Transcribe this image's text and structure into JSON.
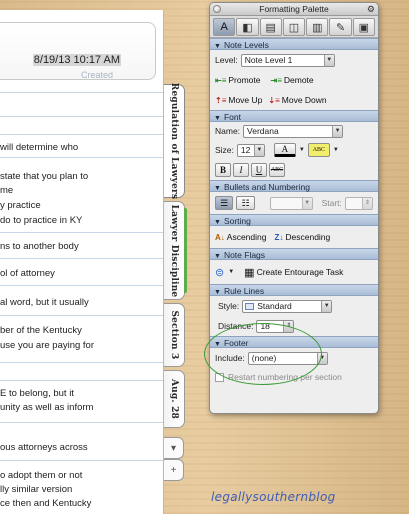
{
  "note": {
    "date_time": "8/19/13 10:17 AM",
    "created_label": "Created",
    "lines": [
      {
        "text": "will determine who"
      },
      {
        "text": "state that you plan to"
      },
      {
        "text": "me"
      },
      {
        "text": "y practice"
      },
      {
        "text": "do to practice in KY"
      },
      {
        "text": "ns to another body"
      },
      {
        "text": "ol of attorney"
      },
      {
        "text": "al word, but it usually"
      },
      {
        "text": "ber of the Kentucky"
      },
      {
        "text": "use you are paying for"
      },
      {
        "text": "E to belong, but it"
      },
      {
        "text": "unity as well as inform"
      },
      {
        "text": "ous attorneys across"
      },
      {
        "text": "o adopt them or not"
      },
      {
        "text": "lly similar version"
      },
      {
        "text": "ce then and Kentucky"
      }
    ]
  },
  "tabs": [
    {
      "label": "Regulation of Lawyers"
    },
    {
      "label": "Lawyer Discipline"
    },
    {
      "label": "Section 3"
    },
    {
      "label": "Aug. 28"
    }
  ],
  "palette": {
    "title": "Formatting Palette",
    "sections": {
      "note_levels": "Note Levels",
      "font": "Font",
      "bullets": "Bullets and Numbering",
      "sorting": "Sorting",
      "note_flags": "Note Flags",
      "rule_lines": "Rule Lines",
      "footer": "Footer"
    },
    "level_label": "Level:",
    "level_value": "Note Level 1",
    "promote": "Promote",
    "demote": "Demote",
    "move_up": "Move Up",
    "move_down": "Move Down",
    "name_label": "Name:",
    "font_name": "Verdana",
    "size_label": "Size:",
    "font_size": "12",
    "abc_label": "ABC",
    "bold": "B",
    "italic": "I",
    "underline": "U",
    "strike": "ABC",
    "start_label": "Start:",
    "ascending": "Ascending",
    "descending": "Descending",
    "create_task": "Create Entourage Task",
    "style_label": "Style:",
    "style_value": "Standard",
    "distance_label": "Distance:",
    "distance_value": "18",
    "include_label": "Include:",
    "include_value": "(none)",
    "restart_label": "Restart numbering per section"
  },
  "watermark": "legallysouthernblog"
}
